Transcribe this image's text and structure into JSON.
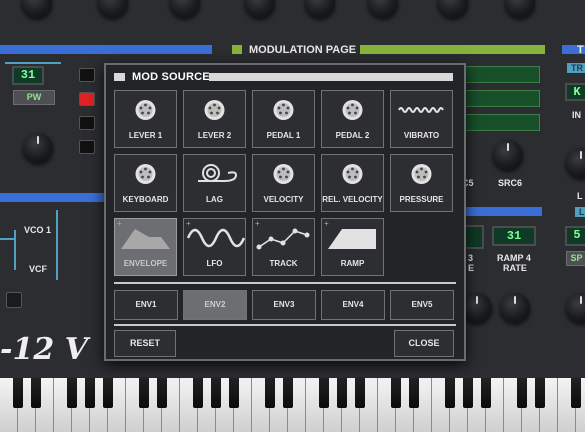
{
  "background": {
    "section_title": "MODULATION PAGE",
    "lcd_left": "31",
    "pw_button": "PW",
    "vco_label": "VCO 1",
    "vcf_label": "VCF",
    "logo_text": "-12 V",
    "src5_label": "C5",
    "src6_label": "SRC6",
    "lcd_right": "31",
    "lcd_far_right": "5",
    "ramp3_label": "3",
    "ramp3_sub": "E",
    "ramp4_label": "RAMP 4",
    "ramp4_sub": "RATE",
    "right_btn": "SP",
    "right_top_label": "T",
    "right_tab": "TR",
    "right_k": "K",
    "right_in": "IN",
    "right_l": "L",
    "right_l2": "L"
  },
  "modal": {
    "title": "MOD SOURCE",
    "row1": [
      {
        "label": "LEVER 1",
        "icon": "din-connector-icon"
      },
      {
        "label": "LEVER 2",
        "icon": "din-connector-icon"
      },
      {
        "label": "PEDAL 1",
        "icon": "din-connector-icon"
      },
      {
        "label": "PEDAL 2",
        "icon": "din-connector-icon"
      },
      {
        "label": "VIBRATO",
        "icon": "vibrato-wave-icon"
      }
    ],
    "row2": [
      {
        "label": "KEYBOARD",
        "icon": "din-connector-icon"
      },
      {
        "label": "LAG",
        "icon": "lag-spiral-icon"
      },
      {
        "label": "VELOCITY",
        "icon": "din-connector-icon"
      },
      {
        "label": "REL. VELOCITY",
        "icon": "din-connector-icon"
      },
      {
        "label": "PRESSURE",
        "icon": "din-connector-icon"
      }
    ],
    "row3": [
      {
        "label": "ENVELOPE",
        "icon": "envelope-shape-icon",
        "selected": true
      },
      {
        "label": "LFO",
        "icon": "sine-wave-icon"
      },
      {
        "label": "TRACK",
        "icon": "track-points-icon"
      },
      {
        "label": "RAMP",
        "icon": "ramp-shape-icon"
      }
    ],
    "envelopes": [
      "ENV1",
      "ENV2",
      "ENV3",
      "ENV4",
      "ENV5"
    ],
    "selected_envelope": "ENV2",
    "reset_label": "RESET",
    "close_label": "CLOSE"
  }
}
